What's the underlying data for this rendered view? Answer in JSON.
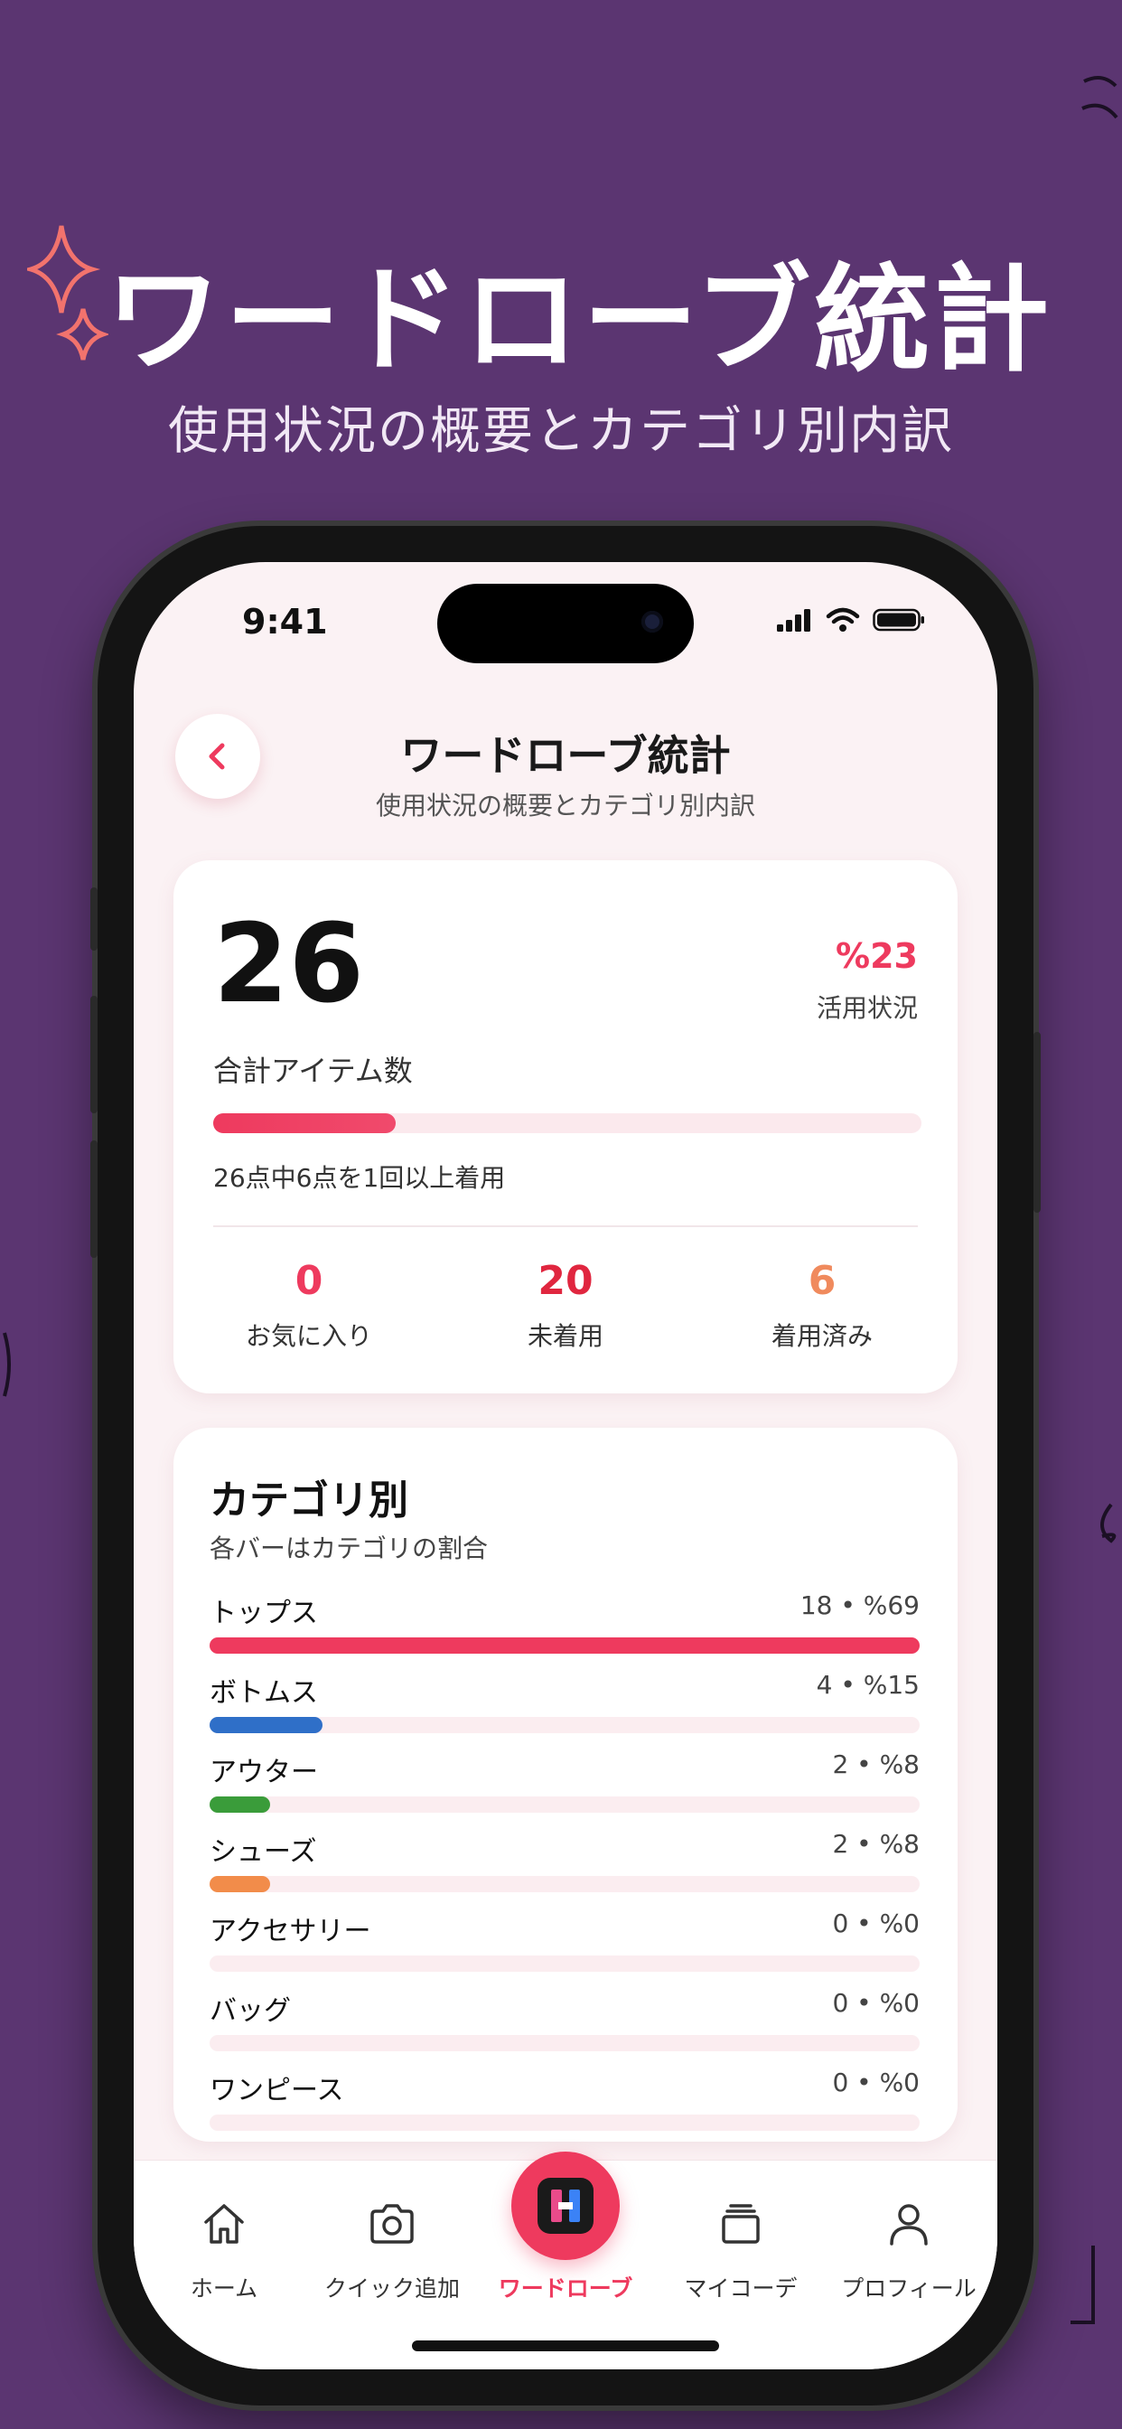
{
  "promo": {
    "title": "ワードローブ統計",
    "subtitle": "使用状況の概要とカテゴリ別内訳"
  },
  "status_bar": {
    "time": "9:41"
  },
  "header": {
    "title": "ワードローブ統計",
    "subtitle": "使用状況の概要とカテゴリ別内訳",
    "back_icon": "chevron-left-icon"
  },
  "summary": {
    "total_items": "26",
    "total_label": "合計アイテム数",
    "utilization_value": "%23",
    "utilization_label": "活用状況",
    "utilization_fraction": 0.23,
    "utilization_note": "26点中6点を1回以上着用",
    "stats": [
      {
        "value": "0",
        "label": "お気に入り",
        "color": "#ee3a5e"
      },
      {
        "value": "20",
        "label": "未着用",
        "color": "#e0263f"
      },
      {
        "value": "6",
        "label": "着用済み",
        "color": "#f08a5d"
      }
    ]
  },
  "categories": {
    "title": "カテゴリ別",
    "subtitle": "各バーはカテゴリの割合",
    "items": [
      {
        "name": "トップス",
        "meta": "18 • %69",
        "fraction": 0.69,
        "color": "#ee3a5e"
      },
      {
        "name": "ボトムス",
        "meta": "4 • %15",
        "fraction": 0.15,
        "color": "#2f6fc8"
      },
      {
        "name": "アウター",
        "meta": "2 • %8",
        "fraction": 0.08,
        "color": "#3a9c3a"
      },
      {
        "name": "シューズ",
        "meta": "2 • %8",
        "fraction": 0.08,
        "color": "#f28c4a"
      },
      {
        "name": "アクセサリー",
        "meta": "0 • %0",
        "fraction": 0,
        "color": "#ee3a5e"
      },
      {
        "name": "バッグ",
        "meta": "0 • %0",
        "fraction": 0,
        "color": "#ee3a5e"
      },
      {
        "name": "ワンピース",
        "meta": "0 • %0",
        "fraction": 0,
        "color": "#ee3a5e"
      }
    ]
  },
  "tabbar": {
    "tabs": [
      {
        "label": "ホーム",
        "icon": "home-icon"
      },
      {
        "label": "クイック追加",
        "icon": "camera-icon"
      },
      {
        "label": "ワードローブ",
        "icon": "wardrobe-icon",
        "active": true
      },
      {
        "label": "マイコーデ",
        "icon": "layers-icon"
      },
      {
        "label": "プロフィール",
        "icon": "person-icon"
      }
    ],
    "active_color": "#ee3a5e"
  }
}
